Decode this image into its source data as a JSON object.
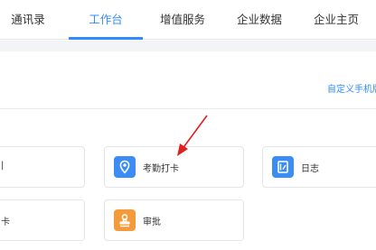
{
  "nav": {
    "tabs": [
      {
        "label": "通讯录",
        "active": false
      },
      {
        "label": "工作台",
        "active": true
      },
      {
        "label": "增值服务",
        "active": false
      },
      {
        "label": "企业数据",
        "active": false
      },
      {
        "label": "企业主页",
        "active": false
      }
    ],
    "active_color": "#2f8cff"
  },
  "toolbar": {
    "custom_mobile_label": "自定义手机版"
  },
  "apps": {
    "partial_top_label": "|",
    "partial_bottom_label": "卡",
    "items": [
      {
        "label": "考勤打卡",
        "icon": "location-pin-icon",
        "icon_color": "#3c8cf6"
      },
      {
        "label": "日志",
        "icon": "log-book-icon",
        "icon_color": "#3c8cf6"
      },
      {
        "label": "审批",
        "icon": "approval-stamp-icon",
        "icon_color": "#f59a3a"
      }
    ]
  },
  "annotation": {
    "arrow_color": "#e02020"
  }
}
